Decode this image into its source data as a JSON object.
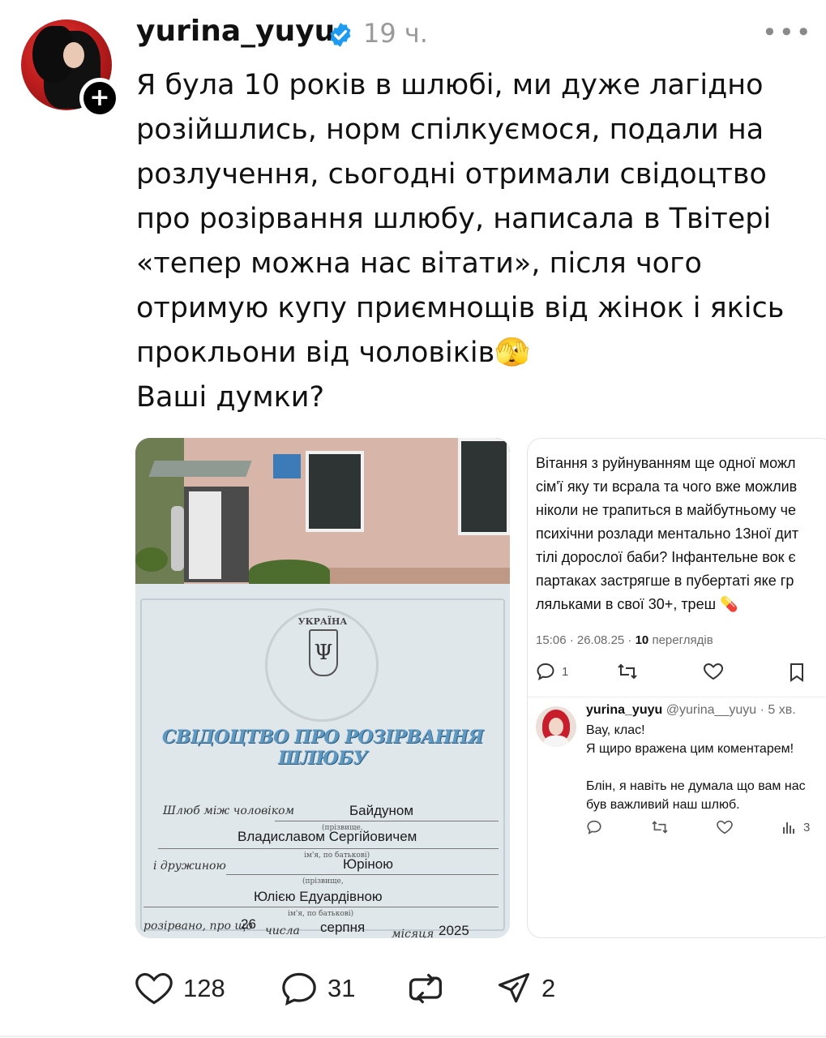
{
  "post": {
    "username": "yurina_yuyu",
    "time_ago": "19 ч.",
    "text": "Я була 10 років в шлюбі, ми дуже лагідно\nрозійшлись, норм спілкуємося, подали на\nрозлучення, сьогодні отримали свідоцтво\nпро розірвання шлюбу, написала в Твітері\n«тепер можна нас вітати», після чого\nотримую купу приємнощів від жінок і якісь\nпрокльони від чоловіків🫣\nВаші думки?",
    "emoji_icon": "face-with-peeking-eye-icon"
  },
  "certificate": {
    "country": "УКРАЇНА",
    "title": "СВІДОЦТВО ПРО РОЗІРВАННЯ ШЛЮБУ",
    "label_between": "Шлюб між чоловіком",
    "husband_surname": "Байдуном",
    "caption_surname": "(прізвище,",
    "husband_name": "Владиславом Сергійовичем",
    "caption_name": "ім'я, по батькові)",
    "label_wife": "і дружиною",
    "wife_surname": "Юріною",
    "wife_name": "Юлією Едуардівною",
    "label_dissolved": "розірвано, про що",
    "day": "26",
    "label_day": "числа",
    "month": "серпня",
    "label_month": "місяця",
    "year": "2025"
  },
  "quoted_tweet": {
    "text_lines": [
      "Вітання з руйнуванням ще одної можл",
      "сім'ї яку ти всрала та чого вже можлив",
      "ніколи не трапиться в майбутньому че",
      "психічни розлади ментально 13ної дит",
      "тілі дорослої баби? Інфантельне вок є",
      "партаках застрягше в пубертаті яке гр",
      "ляльками в свої 30+, треш 💊"
    ],
    "time": "15:06 · 26.08.25 · ",
    "views_count": "10",
    "views_label": "переглядів",
    "reply_count": "1",
    "reply": {
      "name": "yurina_yuyu",
      "handle_time": "@yurina__yuyu · 5 хв.",
      "text": "Вау, клас!\nЯ щиро вражена цим коментарем!\n\nБлін, я навіть не думала що вам нас\nбув важливий наш шлюб.",
      "views_count": "3"
    }
  },
  "actions": {
    "likes": "128",
    "comments": "31",
    "shares": "2"
  },
  "colors": {
    "verified": "#1d9bf0",
    "text": "#111111",
    "muted": "#9a9a9a"
  }
}
